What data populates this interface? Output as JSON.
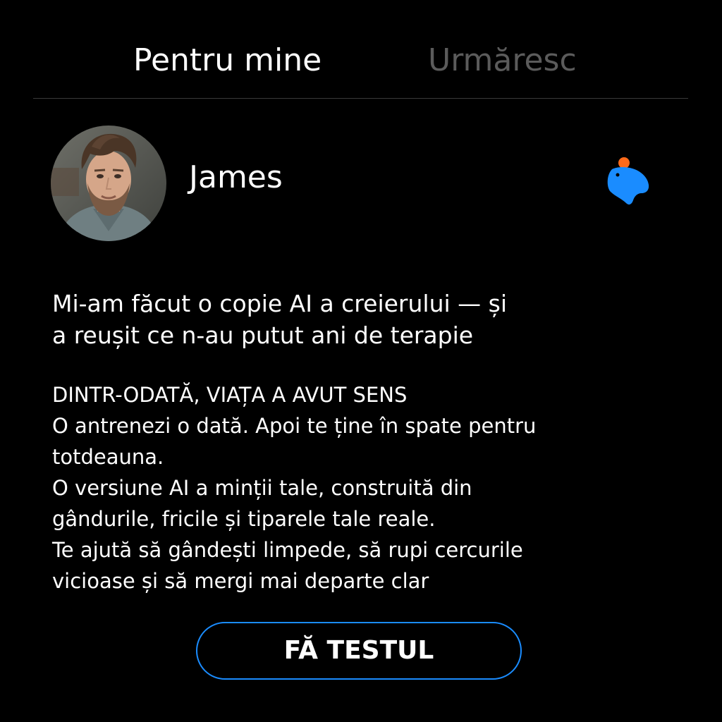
{
  "tabs": [
    {
      "label": "Pentru mine",
      "active": true
    },
    {
      "label": "Urmăresc",
      "active": false
    }
  ],
  "post": {
    "author": "James",
    "headline": [
      "Mi-am făcut o copie AI a creierului — și",
      "a reușit ce n-au putut ani de terapie"
    ],
    "body": [
      "DINTR-ODATĂ, VIAȚA A AVUT SENS",
      "O antrenezi o dată. Apoi te ține în spate pentru",
      "totdeauna.",
      "O versiune AI a minții tale, construită din",
      "gândurile, fricile și tiparele tale reale.",
      "Te ajută să gândești limpede, să rupi cercurile",
      "vicioase și să mergi mai departe clar"
    ],
    "cta_label": "FĂ TESTUL"
  },
  "icons": {
    "brand": "capybara-logo-icon",
    "avatar": "user-avatar"
  },
  "colors": {
    "background": "#000000",
    "text": "#ffffff",
    "inactive_tab": "#5b5b5b",
    "accent": "#1a8cff",
    "logo_dot": "#ff6a1a"
  }
}
